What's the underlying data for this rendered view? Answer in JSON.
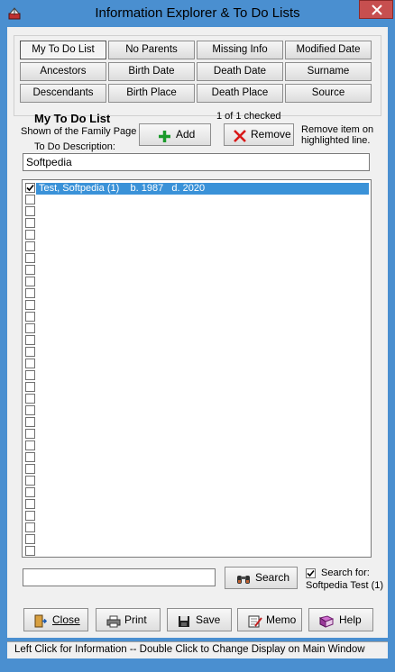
{
  "window": {
    "title": "Information Explorer & To Do Lists"
  },
  "tabs": [
    "My To Do List",
    "No Parents",
    "Missing Info",
    "Modified Date",
    "Ancestors",
    "Birth Date",
    "Death Date",
    "Surname",
    "Descendants",
    "Birth Place",
    "Death Place",
    "Source"
  ],
  "active_tab": "My To Do List",
  "todo": {
    "title": "My To Do List",
    "shown_label": "Shown of the Family Page",
    "desc_label": "To Do Description:",
    "checked_count": "1 of 1 checked",
    "add_label": "Add",
    "remove_label": "Remove",
    "remove_help_1": "Remove item on",
    "remove_help_2": "highlighted line.",
    "description_value": "Softpedia"
  },
  "list": {
    "items": [
      {
        "text": "Test, Softpedia (1)    b. 1987   d. 2020",
        "checked": true,
        "selected": true
      }
    ],
    "empty_rows": 31
  },
  "search": {
    "value": "",
    "button_label": "Search",
    "checkbox_checked": true,
    "for_label": "Search for:",
    "target": "Softpedia Test (1)"
  },
  "bottom_buttons": {
    "close": "Close",
    "print": "Print",
    "save": "Save",
    "memo": "Memo",
    "help": "Help"
  },
  "status": "Left Click for Information -- Double Click to Change Display on Main Window",
  "colors": {
    "title_bar": "#4a8fd0",
    "close_button": "#c74f4f",
    "selection": "#3a92d8",
    "add_green": "#1a9a2a",
    "remove_red": "#d81818"
  }
}
